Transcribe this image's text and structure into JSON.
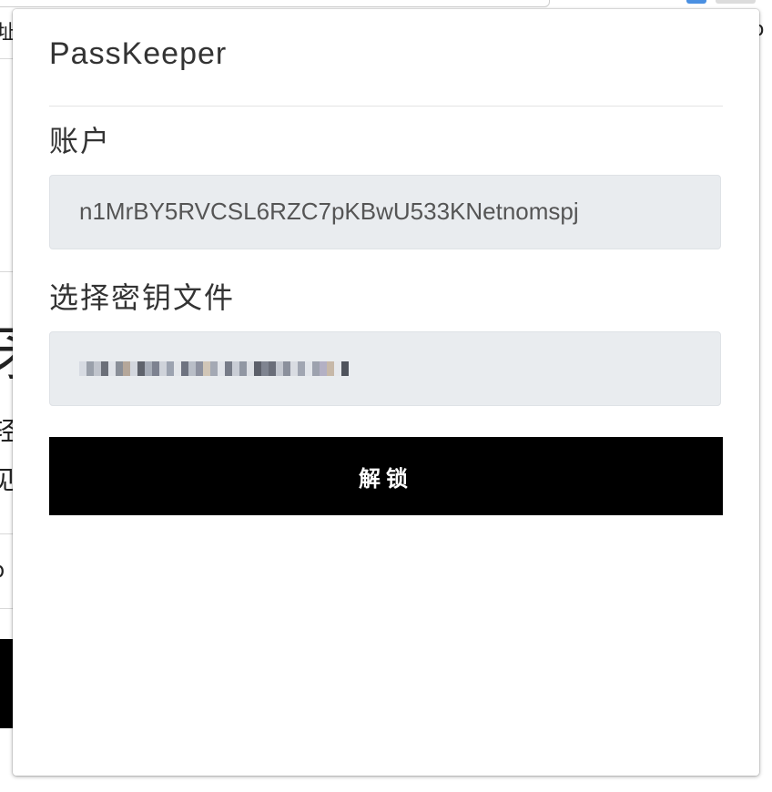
{
  "background": {
    "left_edge_text_top": "址",
    "right_edge_text_top": "o",
    "left_edge_big_char": "矛",
    "left_edge_char_1": "轻",
    "left_edge_char_2": "见",
    "left_edge_char_3": "b"
  },
  "popup": {
    "title": "PassKeeper",
    "account": {
      "label": "账户",
      "value": "n1MrBY5RVCSL6RZC7pKBwU533KNetnomspj"
    },
    "keyfile": {
      "label": "选择密钥文件",
      "value_obscured": true
    },
    "unlock_button_label": "解锁"
  },
  "colors": {
    "button_bg": "#000000",
    "button_text": "#ffffff",
    "input_bg": "#e9ecef"
  }
}
